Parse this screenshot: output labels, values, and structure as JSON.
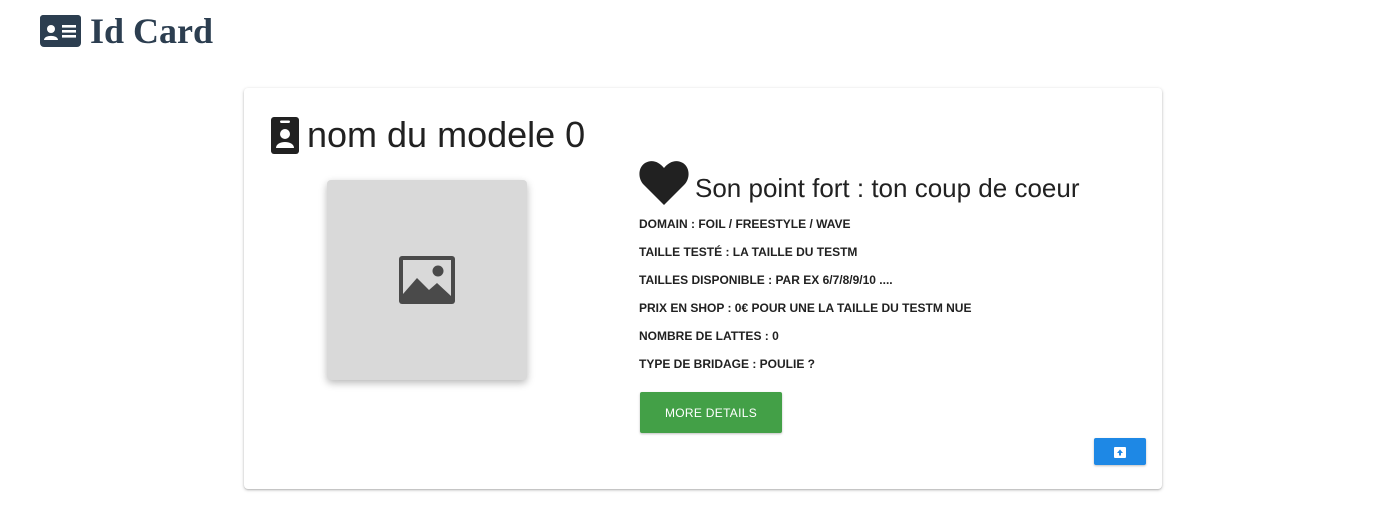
{
  "header": {
    "title": "Id Card",
    "icon": "id-card-icon",
    "color": "#2c3e50"
  },
  "card": {
    "model_icon": "badge-icon",
    "model_name": "nom du modele 0",
    "image_icon": "image-icon",
    "strength_icon": "heart-icon",
    "strength_text": "Son point fort : ton coup de coeur",
    "specs": [
      "DOMAIN : FOIL / FREESTYLE / WAVE",
      "TAILLE TESTÉ : LA TAILLE DU TESTM",
      "TAILLES DISPONIBLE : PAR EX 6/7/8/9/10 ....",
      "PRIX EN SHOP : 0€ POUR UNE LA TAILLE DU TESTM NUE",
      "NOMBRE DE LATTES : 0",
      "TYPE DE BRIDAGE : POULIE ?"
    ],
    "more_button": {
      "label": "MORE DETAILS",
      "color": "#43a047"
    },
    "upload_button": {
      "icon": "upload-image-icon",
      "color": "#1e88e5"
    }
  }
}
